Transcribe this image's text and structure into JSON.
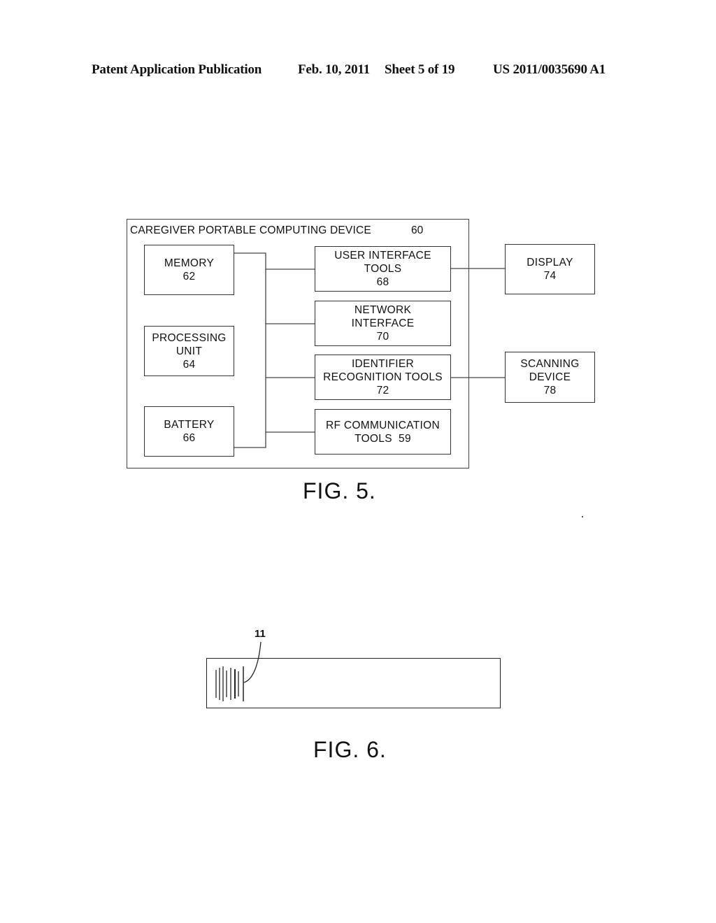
{
  "header": {
    "publication": "Patent Application Publication",
    "date": "Feb. 10, 2011",
    "sheet": "Sheet 5 of 19",
    "number": "US 2011/0035690 A1"
  },
  "fig5": {
    "outer": {
      "title": "CAREGIVER PORTABLE COMPUTING DEVICE",
      "ref": "60"
    },
    "left_blocks": [
      {
        "lines": [
          "MEMORY",
          "62"
        ]
      },
      {
        "lines": [
          "PROCESSING",
          "UNIT",
          "64"
        ]
      },
      {
        "lines": [
          "BATTERY",
          "66"
        ]
      }
    ],
    "right_blocks": [
      {
        "lines": [
          "USER INTERFACE",
          "TOOLS",
          "68"
        ]
      },
      {
        "lines": [
          "NETWORK",
          "INTERFACE",
          "70"
        ]
      },
      {
        "lines": [
          "IDENTIFIER",
          "RECOGNITION TOOLS",
          "72"
        ]
      },
      {
        "lines": [
          "RF COMMUNICATION",
          "TOOLS  59"
        ]
      }
    ],
    "external_blocks": [
      {
        "lines": [
          "DISPLAY",
          "74"
        ]
      },
      {
        "lines": [
          "SCANNING",
          "DEVICE",
          "78"
        ]
      }
    ],
    "caption": "FIG. 5."
  },
  "fig6": {
    "ref": "11",
    "caption": "FIG. 6."
  }
}
